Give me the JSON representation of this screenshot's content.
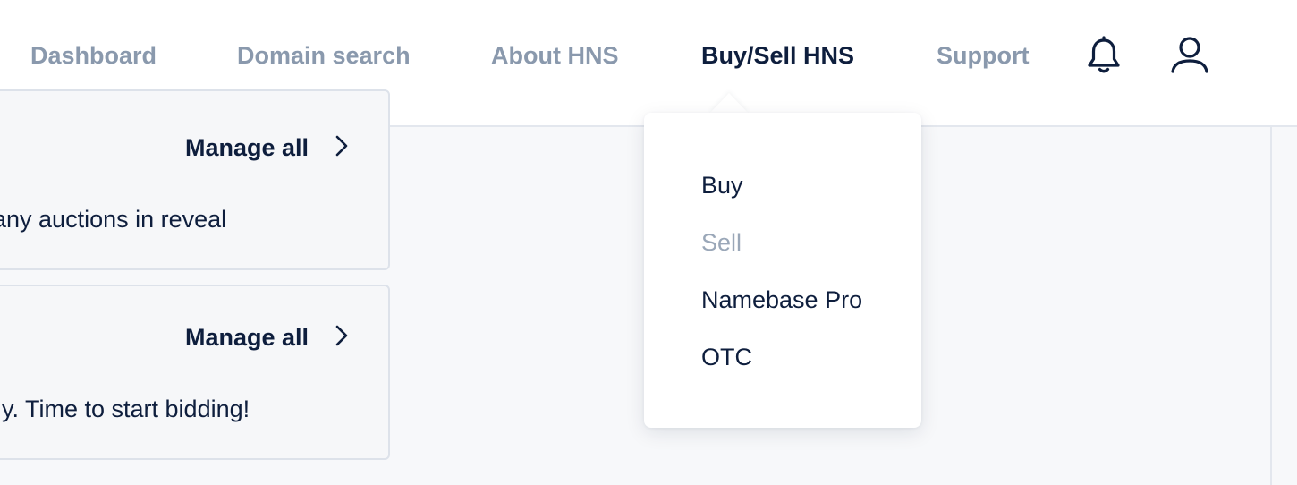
{
  "nav": {
    "items": [
      {
        "label": "Dashboard"
      },
      {
        "label": "Domain search"
      },
      {
        "label": "About HNS"
      },
      {
        "label": "Buy/Sell HNS"
      },
      {
        "label": "Support"
      }
    ],
    "active_item": "Buy/Sell HNS",
    "icons": [
      "bell-icon",
      "user-icon"
    ]
  },
  "cards": [
    {
      "action": "Manage all",
      "text": "any auctions in reveal"
    },
    {
      "action": "Manage all",
      "text": "y. Time to start bidding!"
    }
  ],
  "dropdown": {
    "items": [
      {
        "label": "Buy"
      },
      {
        "label": "Sell"
      },
      {
        "label": "Namebase Pro"
      },
      {
        "label": "OTC"
      }
    ],
    "muted_item": "Sell"
  },
  "colors": {
    "text_dark": "#0e1e3d",
    "text_muted": "#8a99ad",
    "background": "#f7f8fa"
  }
}
